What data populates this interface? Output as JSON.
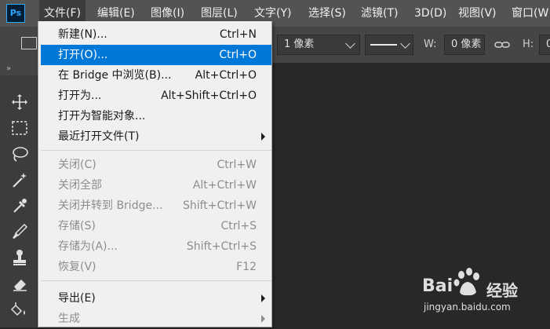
{
  "app": {
    "logo_text": "Ps"
  },
  "menubar": {
    "items": [
      {
        "label": "文件(F)"
      },
      {
        "label": "编辑(E)"
      },
      {
        "label": "图像(I)"
      },
      {
        "label": "图层(L)"
      },
      {
        "label": "文字(Y)"
      },
      {
        "label": "选择(S)"
      },
      {
        "label": "滤镜(T)"
      },
      {
        "label": "3D(D)"
      },
      {
        "label": "视图(V)"
      },
      {
        "label": "窗口(W"
      }
    ]
  },
  "options_bar": {
    "stroke_width_value": "1 像素",
    "width_label": "W:",
    "width_value": "0 像素",
    "height_label": "H:",
    "height_value": "0"
  },
  "tool_panel": {
    "collapse_glyph": "»"
  },
  "file_menu": {
    "items": [
      {
        "label": "新建(N)...",
        "shortcut": "Ctrl+N",
        "enabled": true,
        "highlighted": false
      },
      {
        "label": "打开(O)...",
        "shortcut": "Ctrl+O",
        "enabled": true,
        "highlighted": true
      },
      {
        "label": "在 Bridge 中浏览(B)...",
        "shortcut": "Alt+Ctrl+O",
        "enabled": true,
        "highlighted": false
      },
      {
        "label": "打开为...",
        "shortcut": "Alt+Shift+Ctrl+O",
        "enabled": true,
        "highlighted": false
      },
      {
        "label": "打开为智能对象...",
        "shortcut": "",
        "enabled": true,
        "highlighted": false
      },
      {
        "label": "最近打开文件(T)",
        "shortcut": "",
        "enabled": true,
        "highlighted": false,
        "submenu": true
      },
      {
        "label": "关闭(C)",
        "shortcut": "Ctrl+W",
        "enabled": false,
        "highlighted": false
      },
      {
        "label": "关闭全部",
        "shortcut": "Alt+Ctrl+W",
        "enabled": false,
        "highlighted": false
      },
      {
        "label": "关闭并转到 Bridge...",
        "shortcut": "Shift+Ctrl+W",
        "enabled": false,
        "highlighted": false
      },
      {
        "label": "存储(S)",
        "shortcut": "Ctrl+S",
        "enabled": false,
        "highlighted": false
      },
      {
        "label": "存储为(A)...",
        "shortcut": "Shift+Ctrl+S",
        "enabled": false,
        "highlighted": false
      },
      {
        "label": "恢复(V)",
        "shortcut": "F12",
        "enabled": false,
        "highlighted": false
      },
      {
        "label": "导出(E)",
        "shortcut": "",
        "enabled": true,
        "highlighted": false,
        "submenu": true
      },
      {
        "label": "生成",
        "shortcut": "",
        "enabled": false,
        "highlighted": false,
        "submenu": true
      }
    ]
  },
  "watermark": {
    "brand_left": "Bai",
    "brand_right": "经验",
    "url": "jingyan.baidu.com"
  }
}
